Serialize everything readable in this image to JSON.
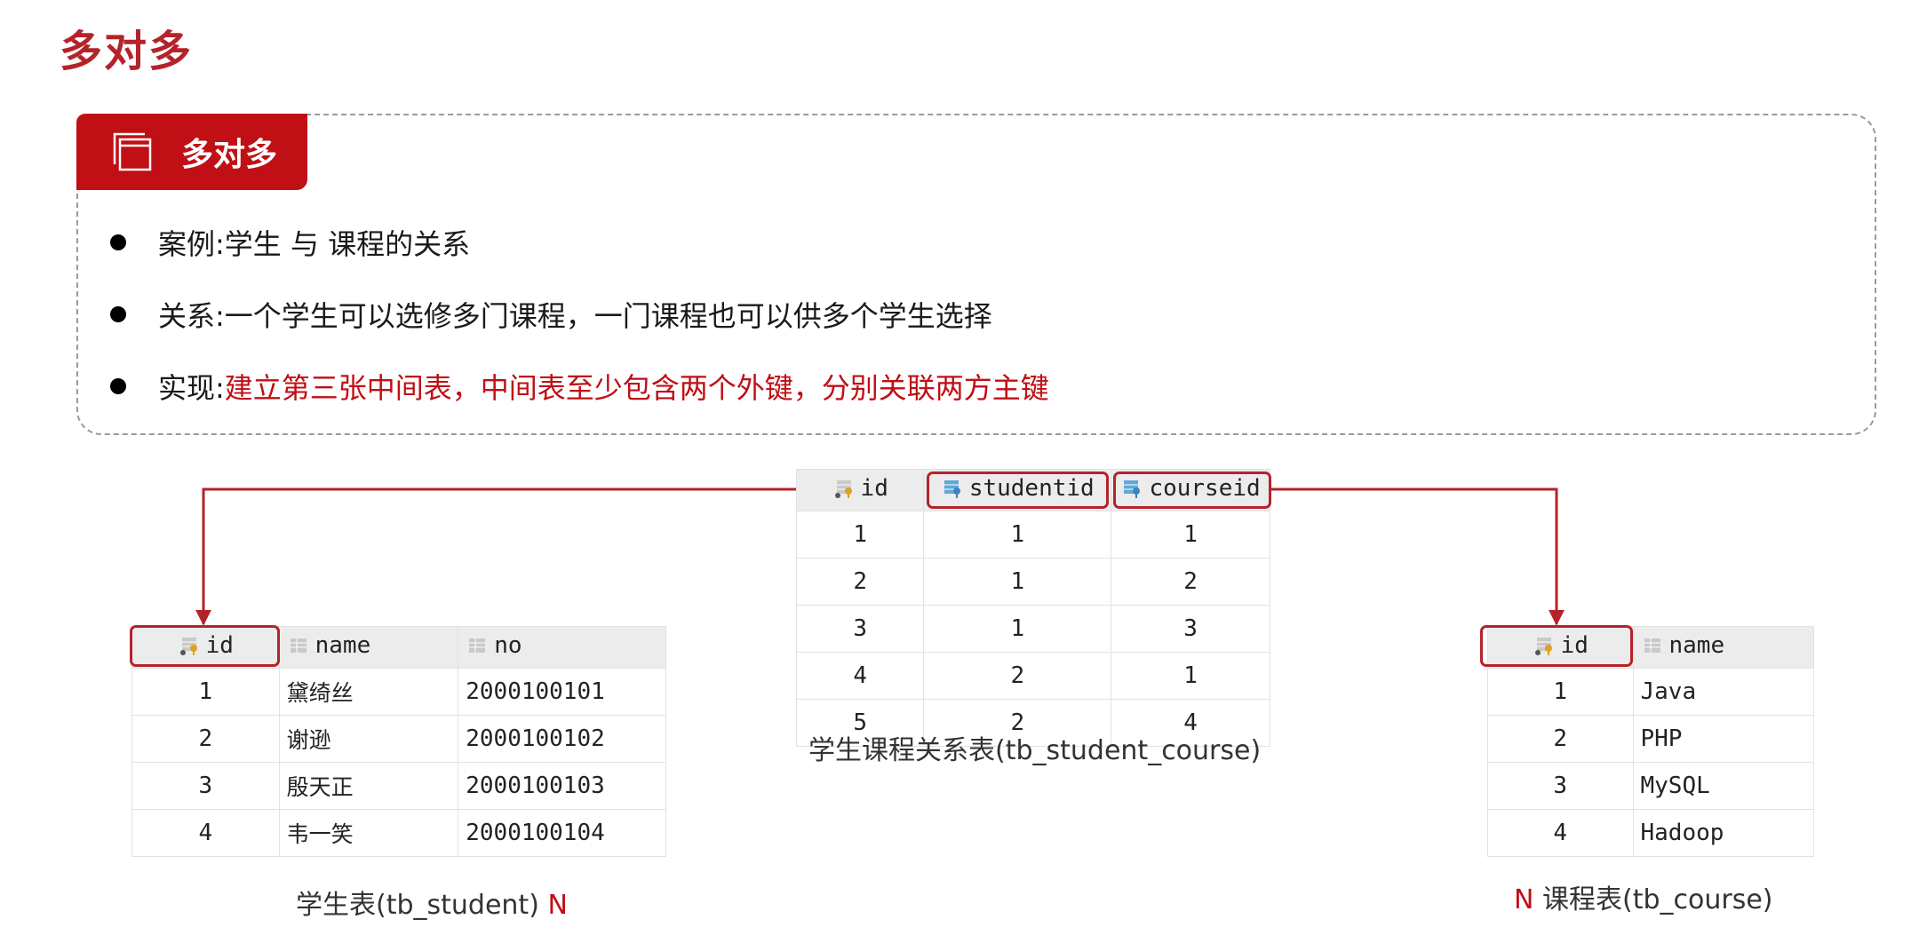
{
  "page_title": "多对多",
  "panel": {
    "tab_label": "多对多",
    "bullets": [
      {
        "label": "案例:",
        "text": " 学生 与 课程的关系"
      },
      {
        "label": "关系:",
        "text": " 一个学生可以选修多门课程，一门课程也可以供多个学生选择"
      },
      {
        "label": "实现:",
        "text": " ",
        "highlight": "建立第三张中间表，中间表至少包含两个外键，分别关联两方主键"
      }
    ]
  },
  "student_table": {
    "headers": [
      "id",
      "name",
      "no"
    ],
    "rows": [
      [
        "1",
        "黛绮丝",
        "2000100101"
      ],
      [
        "2",
        "谢逊",
        "2000100102"
      ],
      [
        "3",
        "殷天正",
        "2000100103"
      ],
      [
        "4",
        "韦一笑",
        "2000100104"
      ]
    ],
    "caption": "学生表(tb_student)",
    "cardinality": "N"
  },
  "relation_table": {
    "headers": [
      "id",
      "studentid",
      "courseid"
    ],
    "rows": [
      [
        "1",
        "1",
        "1"
      ],
      [
        "2",
        "1",
        "2"
      ],
      [
        "3",
        "1",
        "3"
      ],
      [
        "4",
        "2",
        "1"
      ],
      [
        "5",
        "2",
        "4"
      ]
    ],
    "caption": "学生课程关系表(tb_student_course)"
  },
  "course_table": {
    "headers": [
      "id",
      "name"
    ],
    "rows": [
      [
        "1",
        "Java"
      ],
      [
        "2",
        "PHP"
      ],
      [
        "3",
        "MySQL"
      ],
      [
        "4",
        "Hadoop"
      ]
    ],
    "caption": "课程表(tb_course)",
    "cardinality": "N"
  },
  "colors": {
    "accent": "#c00f15",
    "title": "#b5232a",
    "connector": "#b5232a"
  },
  "icons": {
    "tab": "window-stack-icon",
    "primary_key": "key-column-icon",
    "foreign_key": "foreign-key-column-icon",
    "column": "column-icon"
  }
}
